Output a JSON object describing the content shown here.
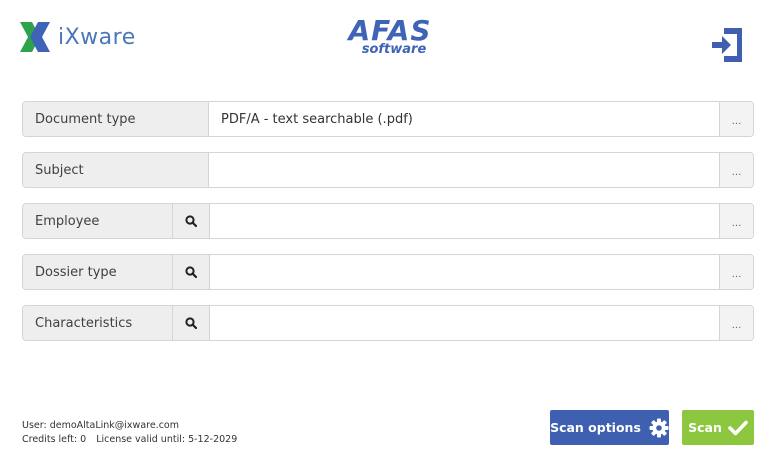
{
  "header": {
    "brand_name": "iXware",
    "afas_title": "AFAS",
    "afas_subtitle": "software",
    "logout_icon": "logout-door-icon"
  },
  "fields": [
    {
      "label": "Document type",
      "value": "PDF/A - text searchable (.pdf)",
      "browse": "...",
      "has_search": false
    },
    {
      "label": "Subject",
      "value": "",
      "browse": "...",
      "has_search": false
    },
    {
      "label": "Employee",
      "value": "",
      "browse": "...",
      "has_search": true
    },
    {
      "label": "Dossier type",
      "value": "",
      "browse": "...",
      "has_search": true
    },
    {
      "label": "Characteristics",
      "value": "",
      "browse": "...",
      "has_search": true
    }
  ],
  "footer": {
    "user": "User: demoAltaLink@ixware.com",
    "credits": "Credits left: 0",
    "license": "License valid until: 5-12-2029"
  },
  "buttons": {
    "scan_options": "Scan options",
    "scan": "Scan"
  },
  "colors": {
    "brand_blue": "#3f5fb1",
    "scan_green": "#8dc63f",
    "label_bg": "#eeeeee"
  }
}
